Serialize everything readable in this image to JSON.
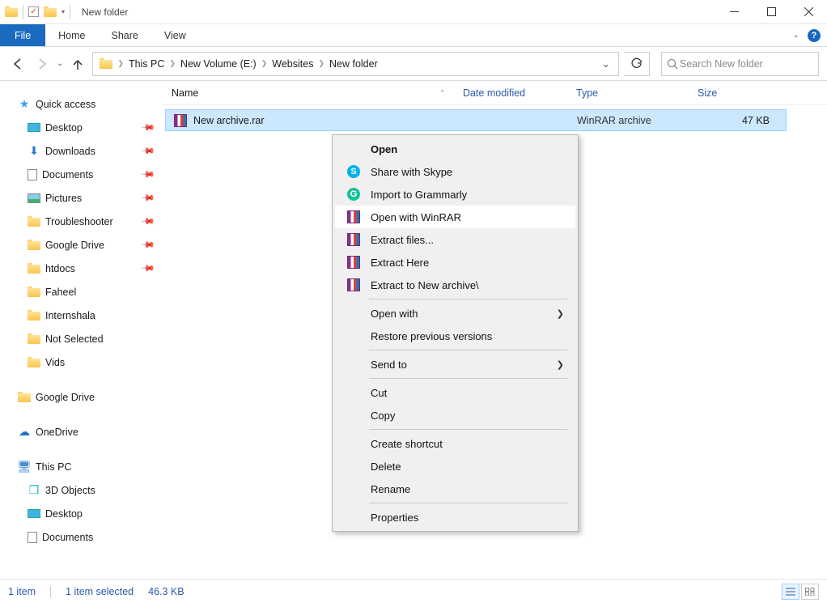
{
  "window": {
    "title": "New folder"
  },
  "ribbon": {
    "file": "File",
    "tabs": [
      "Home",
      "Share",
      "View"
    ]
  },
  "breadcrumbs": [
    "This PC",
    "New Volume (E:)",
    "Websites",
    "New folder"
  ],
  "search": {
    "placeholder": "Search New folder"
  },
  "columns": {
    "name": "Name",
    "date": "Date modified",
    "type": "Type",
    "size": "Size"
  },
  "tree": {
    "quick_access": "Quick access",
    "quick_items": [
      {
        "label": "Desktop",
        "icon": "monitor",
        "pinned": true
      },
      {
        "label": "Downloads",
        "icon": "dl",
        "pinned": true
      },
      {
        "label": "Documents",
        "icon": "doc",
        "pinned": true
      },
      {
        "label": "Pictures",
        "icon": "pic",
        "pinned": true
      },
      {
        "label": "Troubleshooter",
        "icon": "folder",
        "pinned": true
      },
      {
        "label": "Google Drive",
        "icon": "folder",
        "pinned": true
      },
      {
        "label": "htdocs",
        "icon": "folder",
        "pinned": true
      },
      {
        "label": "Faheel",
        "icon": "folder",
        "pinned": false
      },
      {
        "label": "Internshala",
        "icon": "folder",
        "pinned": false
      },
      {
        "label": "Not Selected",
        "icon": "folder",
        "pinned": false
      },
      {
        "label": "Vids",
        "icon": "folder",
        "pinned": false
      }
    ],
    "google_drive": "Google Drive",
    "onedrive": "OneDrive",
    "this_pc": "This PC",
    "pc_items": [
      {
        "label": "3D Objects",
        "icon": "cube"
      },
      {
        "label": "Desktop",
        "icon": "monitor"
      },
      {
        "label": "Documents",
        "icon": "doc"
      }
    ]
  },
  "file_row": {
    "name": "New archive.rar",
    "type": "WinRAR archive",
    "size": "47 KB"
  },
  "context_menu": {
    "open": "Open",
    "skype": "Share with Skype",
    "grammarly": "Import to Grammarly",
    "open_winrar": "Open with WinRAR",
    "extract_files": "Extract files...",
    "extract_here": "Extract Here",
    "extract_to": "Extract to New archive\\",
    "open_with": "Open with",
    "restore": "Restore previous versions",
    "send_to": "Send to",
    "cut": "Cut",
    "copy": "Copy",
    "shortcut": "Create shortcut",
    "delete": "Delete",
    "rename": "Rename",
    "properties": "Properties"
  },
  "status": {
    "count": "1 item",
    "selected": "1 item selected",
    "size": "46.3 KB"
  }
}
